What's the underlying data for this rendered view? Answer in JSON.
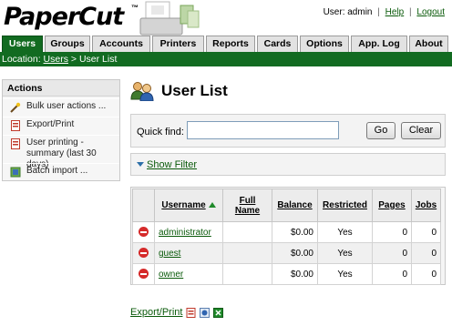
{
  "app": {
    "logo_text": "PaperCut",
    "trademark": "™"
  },
  "userbar": {
    "user_label": "User: admin",
    "sep": "|",
    "help": "Help",
    "logout": "Logout"
  },
  "tabs": [
    "Users",
    "Groups",
    "Accounts",
    "Printers",
    "Reports",
    "Cards",
    "Options",
    "App. Log",
    "About"
  ],
  "active_tab": "Users",
  "breadcrumb": {
    "prefix": "Location:",
    "users": "Users",
    "sep": ">",
    "current": "User List"
  },
  "actions": {
    "title": "Actions",
    "items": [
      {
        "label": "Bulk user actions ...",
        "icon": "wand-icon"
      },
      {
        "label": "Export/Print",
        "icon": "pdf-icon"
      },
      {
        "label": "User printing - summary (last 30 days)",
        "icon": "pdf-icon"
      },
      {
        "label": "Batch import ...",
        "icon": "import-icon"
      }
    ]
  },
  "page": {
    "title": "User List"
  },
  "quick_find": {
    "label": "Quick find:",
    "value": "",
    "go": "Go",
    "clear": "Clear"
  },
  "show_filter": "Show Filter",
  "table": {
    "headers": {
      "username": "Username",
      "full_name_1": "Full",
      "full_name_2": "Name",
      "balance": "Balance",
      "restricted": "Restricted",
      "pages": "Pages",
      "jobs": "Jobs"
    },
    "rows": [
      {
        "username": "administrator",
        "full_name": "",
        "balance": "$0.00",
        "restricted": "Yes",
        "pages": "0",
        "jobs": "0"
      },
      {
        "username": "guest",
        "full_name": "",
        "balance": "$0.00",
        "restricted": "Yes",
        "pages": "0",
        "jobs": "0"
      },
      {
        "username": "owner",
        "full_name": "",
        "balance": "$0.00",
        "restricted": "Yes",
        "pages": "0",
        "jobs": "0"
      }
    ]
  },
  "footer": {
    "export": "Export/Print"
  },
  "colors": {
    "brand_green": "#126b21",
    "link_green": "#0a5a0a",
    "delete_red": "#d52a2a"
  }
}
